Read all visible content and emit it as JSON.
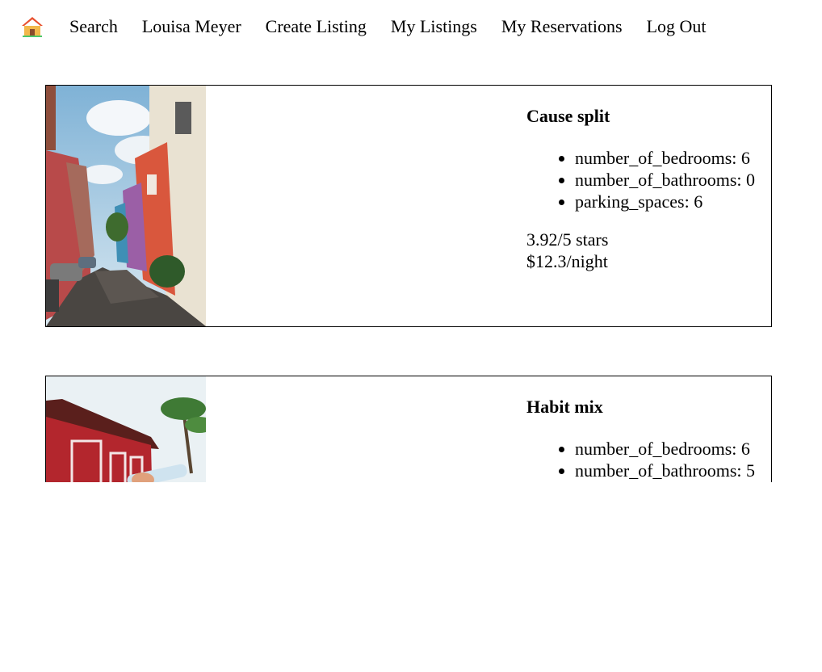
{
  "nav": {
    "home_icon": "house-icon",
    "items": [
      {
        "label": "Search"
      },
      {
        "label": "Louisa Meyer"
      },
      {
        "label": "Create Listing"
      },
      {
        "label": "My Listings"
      },
      {
        "label": "My Reservations"
      },
      {
        "label": "Log Out"
      }
    ]
  },
  "listings": [
    {
      "title": "Cause split",
      "features": [
        "number_of_bedrooms: 6",
        "number_of_bathrooms: 0",
        "parking_spaces: 6"
      ],
      "rating": "3.92/5 stars",
      "price": "$12.3/night",
      "photo": "street-photo"
    },
    {
      "title": "Habit mix",
      "features": [
        "number_of_bedrooms: 6",
        "number_of_bathrooms: 5"
      ],
      "photo": "red-house-photo"
    }
  ]
}
